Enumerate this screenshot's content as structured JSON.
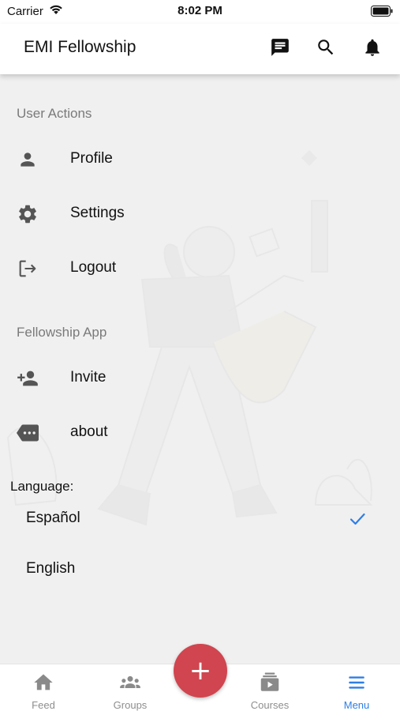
{
  "status_bar": {
    "carrier": "Carrier",
    "time": "8:02 PM"
  },
  "app_bar": {
    "title": "EMI Fellowship",
    "icons": [
      "chat-icon",
      "search-icon",
      "bell-icon"
    ]
  },
  "menu": {
    "user_actions_header": "User Actions",
    "user_actions": [
      {
        "label": "Profile",
        "icon": "person-icon"
      },
      {
        "label": "Settings",
        "icon": "gear-icon"
      },
      {
        "label": "Logout",
        "icon": "logout-icon"
      }
    ],
    "fellowship_header": "Fellowship App",
    "fellowship_items": [
      {
        "label": "Invite",
        "icon": "add-person-icon"
      },
      {
        "label": "about",
        "icon": "more-tag-icon"
      }
    ]
  },
  "language": {
    "label": "Language:",
    "options": [
      {
        "label": "Español",
        "selected": true
      },
      {
        "label": "English",
        "selected": false
      }
    ]
  },
  "fab": {
    "symbol": "+",
    "color": "#d0454f"
  },
  "tab_bar": {
    "tabs": [
      {
        "label": "Feed",
        "icon": "home-icon",
        "active": false
      },
      {
        "label": "Groups",
        "icon": "groups-icon",
        "active": false
      },
      {
        "label": "Courses",
        "icon": "video-library-icon",
        "active": false
      },
      {
        "label": "Menu",
        "icon": "hamburger-icon",
        "active": true
      }
    ],
    "active_color": "#2f7ee6",
    "inactive_color": "#8e8e8e"
  }
}
